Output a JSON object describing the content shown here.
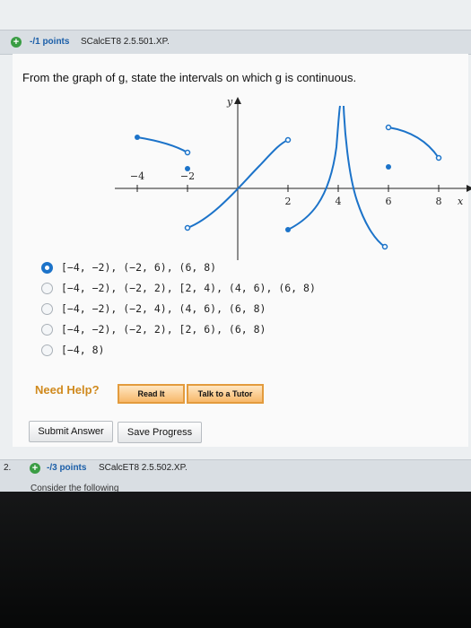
{
  "question": {
    "points": "-/1 points",
    "source": "SCalcET8 2.5.501.XP.",
    "prompt": "From the graph of g, state the intervals on which g is continuous."
  },
  "graph": {
    "y_label": "y",
    "x_label": "x",
    "x_ticks": [
      "−4",
      "−2",
      "2",
      "4",
      "6",
      "8"
    ]
  },
  "choices": [
    {
      "label": "[−4, −2), (−2, 6), (6, 8)",
      "selected": true
    },
    {
      "label": "[−4, −2), (−2, 2), [2, 4), (4, 6), (6, 8)",
      "selected": false
    },
    {
      "label": "[−4, −2), (−2, 4), (4, 6), (6, 8)",
      "selected": false
    },
    {
      "label": "[−4, −2), (−2, 2), [2, 6), (6, 8)",
      "selected": false
    },
    {
      "label": "[−4, 8)",
      "selected": false
    }
  ],
  "help": {
    "label": "Need Help?",
    "read_it": "Read It",
    "talk_to_tutor": "Talk to a Tutor"
  },
  "actions": {
    "submit": "Submit Answer",
    "save": "Save Progress"
  },
  "next_question": {
    "number": "2.",
    "points": "-/3 points",
    "source": "SCalcET8 2.5.502.XP.",
    "text": "Consider the following"
  }
}
